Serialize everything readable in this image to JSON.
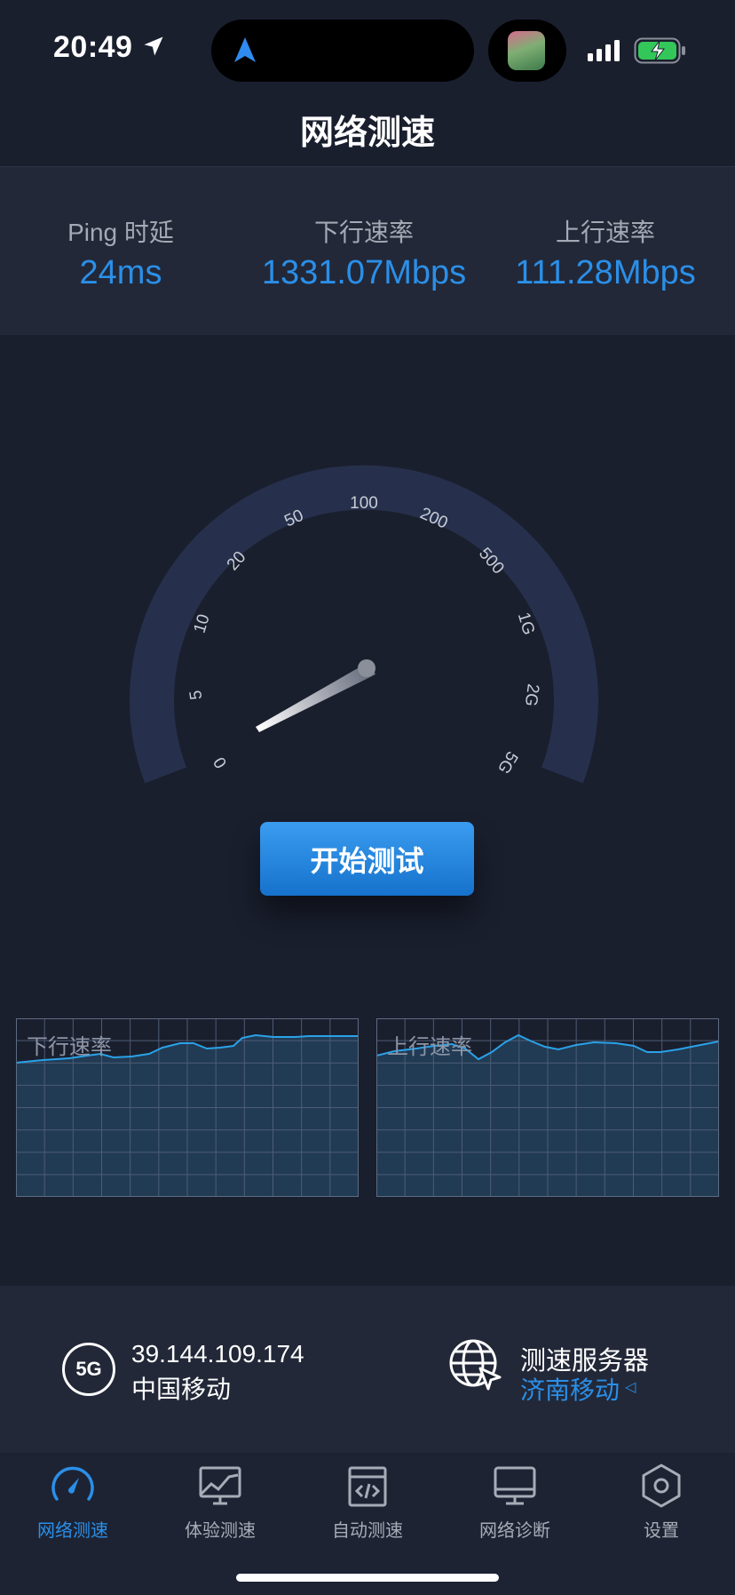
{
  "status_bar": {
    "time": "20:49"
  },
  "header": {
    "title": "网络测速"
  },
  "stats": [
    {
      "label": "Ping 时延",
      "value": "24ms"
    },
    {
      "label": "下行速率",
      "value": "1331.07Mbps"
    },
    {
      "label": "上行速率",
      "value": "111.28Mbps"
    }
  ],
  "gauge": {
    "ticks": [
      "0",
      "5",
      "10",
      "20",
      "50",
      "100",
      "200",
      "500",
      "1G",
      "2G",
      "5G"
    ],
    "needle_value": "0"
  },
  "start_button": {
    "label": "开始测试"
  },
  "charts": {
    "download": {
      "label": "下行速率"
    },
    "upload": {
      "label": "上行速率"
    }
  },
  "network": {
    "badge": "5G",
    "ip": "39.144.109.174",
    "carrier": "中国移动"
  },
  "server": {
    "title": "测速服务器",
    "name": "济南移动"
  },
  "tabs": [
    {
      "label": "网络测速",
      "icon": "speedometer-icon",
      "active": true
    },
    {
      "label": "体验测速",
      "icon": "chart-monitor-icon",
      "active": false
    },
    {
      "label": "自动测速",
      "icon": "code-window-icon",
      "active": false
    },
    {
      "label": "网络诊断",
      "icon": "desktop-icon",
      "active": false
    },
    {
      "label": "设置",
      "icon": "hexagon-gear-icon",
      "active": false
    }
  ],
  "colors": {
    "accent": "#2b8fe8",
    "background": "#1a1f2e",
    "panel": "#222838",
    "gauge_arc": "#26304c"
  }
}
